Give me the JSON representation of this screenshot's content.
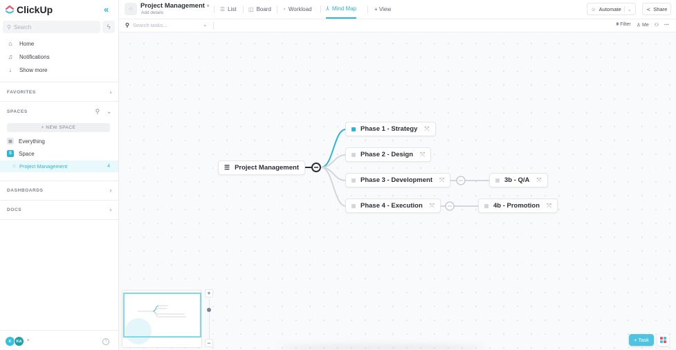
{
  "app": {
    "name": "ClickUp"
  },
  "sidebar": {
    "search_placeholder": "Search",
    "nav": [
      {
        "label": "Home",
        "icon": "home-icon"
      },
      {
        "label": "Notifications",
        "icon": "bell-icon"
      },
      {
        "label": "Show more",
        "icon": "arrow-down-icon"
      }
    ],
    "favorites_label": "FAVORITES",
    "spaces_label": "SPACES",
    "new_space_label": "+ NEW SPACE",
    "everything_label": "Everything",
    "space": {
      "initial": "S",
      "label": "Space",
      "color": "#2ab6d8"
    },
    "project": {
      "label": "Project Management",
      "count": "4"
    },
    "dashboards_label": "DASHBOARDS",
    "docs_label": "DOCS",
    "users": [
      {
        "initials": "K",
        "color": "#35c0de"
      },
      {
        "initials": "KA",
        "color": "#21a0a8"
      }
    ]
  },
  "header": {
    "title": "Project Management",
    "subtitle": "Add details",
    "views": [
      {
        "label": "List",
        "icon": "list-icon"
      },
      {
        "label": "Board",
        "icon": "board-icon"
      },
      {
        "label": "Workload",
        "icon": "gauge-icon"
      },
      {
        "label": "Mind Map",
        "icon": "mindmap-icon",
        "active": true
      }
    ],
    "add_view_label": "+ View",
    "automate_label": "Automate",
    "share_label": "Share"
  },
  "toolbar": {
    "search_placeholder": "Search tasks...",
    "filter_label": "Filter",
    "me_label": "Me"
  },
  "mindmap": {
    "root": "Project Management",
    "nodes": [
      {
        "label": "Phase 1 - Strategy",
        "active": true
      },
      {
        "label": "Phase 2 - Design"
      },
      {
        "label": "Phase 3 - Development",
        "child": "3b - Q/A"
      },
      {
        "label": "Phase 4 - Execution",
        "child": "4b - Promotion"
      }
    ],
    "accent": "#2ab6d8"
  },
  "actions": {
    "add_task_label": "+ Task"
  }
}
